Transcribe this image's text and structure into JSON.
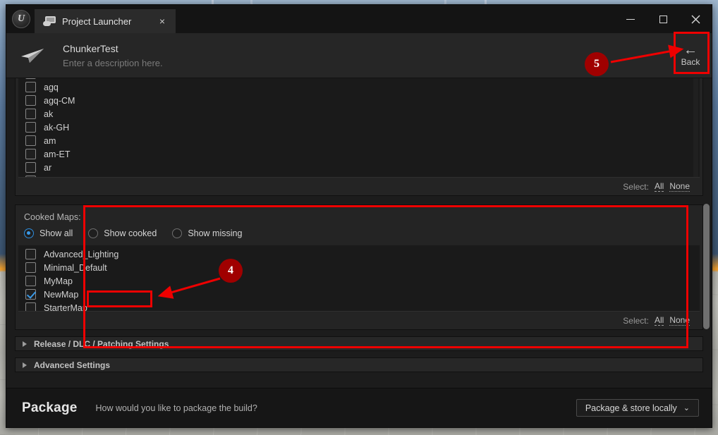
{
  "window": {
    "titlebar": {
      "logo_icon": "unreal-engine-logo-icon",
      "tab_icon": "game-monitor-icon",
      "tab_title": "Project Launcher",
      "close_glyph": "×",
      "minimize_tooltip": "Minimize",
      "maximize_tooltip": "Maximize",
      "close_tooltip": "Close"
    },
    "header": {
      "plane_icon": "paper-plane-icon",
      "project_name": "ChunkerTest",
      "description_placeholder": "Enter a description here.",
      "back_label": "Back",
      "back_arrow": "←"
    }
  },
  "language_section": {
    "items": [
      {
        "label": "agq",
        "checked": false
      },
      {
        "label": "agq-CM",
        "checked": false
      },
      {
        "label": "ak",
        "checked": false
      },
      {
        "label": "ak-GH",
        "checked": false
      },
      {
        "label": "am",
        "checked": false
      },
      {
        "label": "am-ET",
        "checked": false
      },
      {
        "label": "ar",
        "checked": false
      }
    ],
    "select_label": "Select:",
    "select_all": "All",
    "select_none": "None"
  },
  "cooked_maps": {
    "title": "Cooked Maps:",
    "filters": [
      {
        "label": "Show all",
        "selected": true
      },
      {
        "label": "Show cooked",
        "selected": false
      },
      {
        "label": "Show missing",
        "selected": false
      }
    ],
    "maps": [
      {
        "label": "Advanced_Lighting",
        "checked": false
      },
      {
        "label": "Minimal_Default",
        "checked": false
      },
      {
        "label": "MyMap",
        "checked": false
      },
      {
        "label": "NewMap",
        "checked": true
      },
      {
        "label": "StarterMap",
        "checked": false
      }
    ],
    "select_label": "Select:",
    "select_all": "All",
    "select_none": "None"
  },
  "collapsibles": [
    {
      "label": "Release / DLC / Patching Settings",
      "expanded": false
    },
    {
      "label": "Advanced Settings",
      "expanded": false
    }
  ],
  "package_bar": {
    "title": "Package",
    "question": "How would you like to package the build?",
    "dropdown_value": "Package & store locally",
    "dropdown_chevron": "⌄"
  },
  "annotations": {
    "accent_color": "#ee0000",
    "badge_color": "#a00000",
    "callouts": [
      {
        "number": "4",
        "target": "newmap-checkbox-row"
      },
      {
        "number": "5",
        "target": "back-button"
      }
    ]
  }
}
